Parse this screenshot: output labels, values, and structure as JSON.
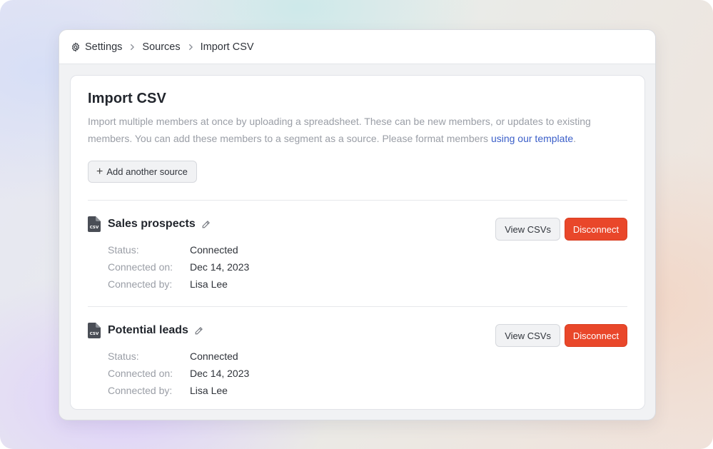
{
  "breadcrumb": {
    "items": [
      {
        "label": "Settings",
        "icon": "gear-icon"
      },
      {
        "label": "Sources"
      },
      {
        "label": "Import CSV"
      }
    ]
  },
  "page": {
    "title": "Import CSV",
    "description_text": "Import multiple members at once by uploading a spreadsheet. These can be new members, or updates to existing members. You can add these members to a segment as a source. Please format members ",
    "template_link": "using our template",
    "description_end": ".",
    "add_source_label": "Add another source"
  },
  "meta_labels": {
    "status": "Status:",
    "connected_on": "Connected on:",
    "connected_by": "Connected by:"
  },
  "sources": [
    {
      "name": "Sales prospects",
      "status": "Connected",
      "connected_on": "Dec 14, 2023",
      "connected_by": "Lisa Lee",
      "view_label": "View CSVs",
      "disconnect_label": "Disconnect"
    },
    {
      "name": "Potential leads",
      "status": "Connected",
      "connected_on": "Dec 14, 2023",
      "connected_by": "Lisa Lee",
      "view_label": "View CSVs",
      "disconnect_label": "Disconnect"
    }
  ],
  "icons": {
    "csv_file": "CSV"
  },
  "colors": {
    "accent_link": "#3b5fc9",
    "danger": "#e9472a"
  }
}
